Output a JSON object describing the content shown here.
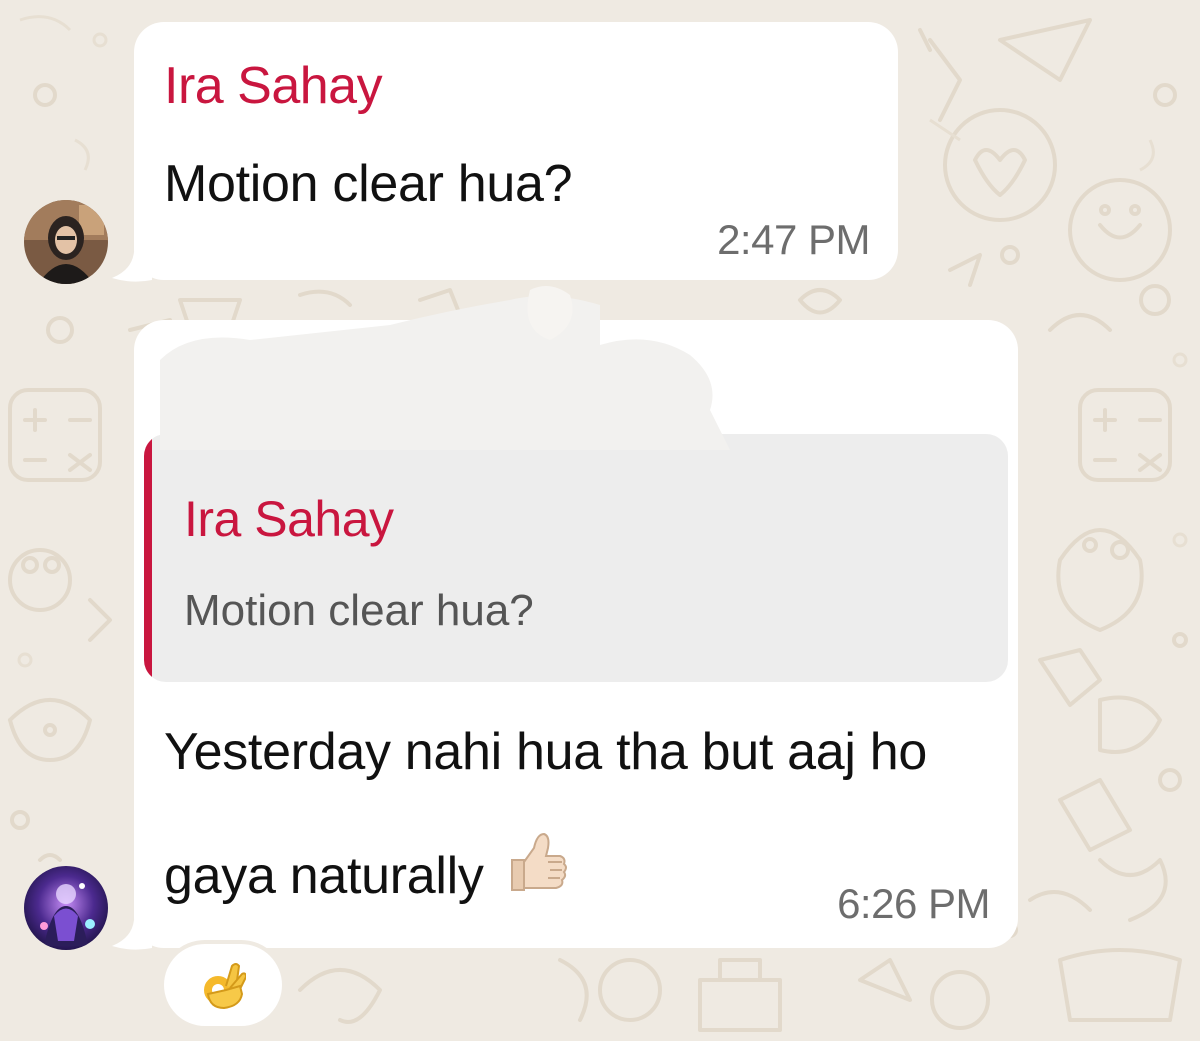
{
  "theme": {
    "wallpaper_color": "#efeae2",
    "sender_color": "#c9163f",
    "bubble_color": "#ffffff",
    "quote_background": "#ededed"
  },
  "messages": [
    {
      "sender": "Ira Sahay",
      "text": "Motion clear hua?",
      "time": "2:47 PM",
      "avatar": "profile-photo-woman"
    },
    {
      "quoted": {
        "sender": "Ira Sahay",
        "text": "Motion clear hua?"
      },
      "text": "Yesterday nahi hua tha but aaj ho gaya naturally",
      "emoji": "thumbs-up-light-skin-icon",
      "time": "6:26 PM",
      "avatar": "profile-photo-dark-art"
    }
  ],
  "reaction": {
    "emoji": "ok-hand-icon"
  }
}
